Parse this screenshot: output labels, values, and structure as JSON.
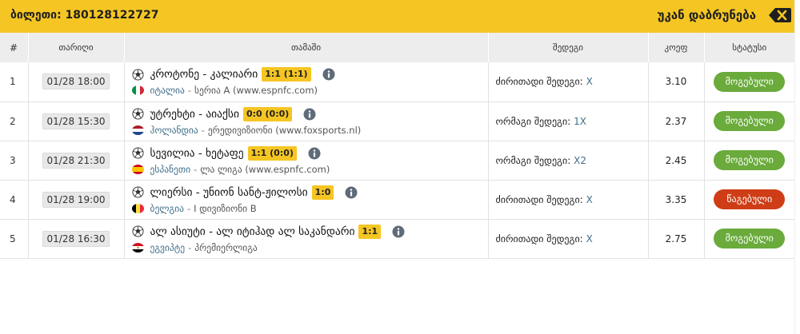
{
  "header": {
    "ticket_label": "ბილეთი:",
    "ticket_number": "180128122727",
    "back_label": "უკან დაბრუნება",
    "back_icon": "backspace-icon"
  },
  "table": {
    "columns": [
      "#",
      "თარიღი",
      "თამაში",
      "შედეგი",
      "კოეფ",
      "სტატუსი"
    ],
    "rows": [
      {
        "num": "1",
        "date": "01/28 18:00",
        "match": "კროტონე - კალიარი",
        "score": "1:1 (1:1)",
        "country": "იტალია",
        "league": "სერია A (www.espnfc.com)",
        "flag": "italy",
        "result_label": "ძირითადი შედეგი:",
        "pick": "X",
        "odds": "3.10",
        "status": "მოგებული",
        "status_type": "won"
      },
      {
        "num": "2",
        "date": "01/28 15:30",
        "match": "უტრეხტი - აიაქსი",
        "score": "0:0 (0:0)",
        "country": "ჰოლანდია",
        "league": "ერედივიზიონი (www.foxsports.nl)",
        "flag": "netherlands",
        "result_label": "ორმაგი შედეგი:",
        "pick": "1X",
        "odds": "2.37",
        "status": "მოგებული",
        "status_type": "won"
      },
      {
        "num": "3",
        "date": "01/28 21:30",
        "match": "სევილია - ხეტაფე",
        "score": "1:1 (0:0)",
        "country": "ესპანეთი",
        "league": "ლა ლიგა (www.espnfc.com)",
        "flag": "spain",
        "result_label": "ორმაგი შედეგი:",
        "pick": "X2",
        "odds": "2.45",
        "status": "მოგებული",
        "status_type": "won"
      },
      {
        "num": "4",
        "date": "01/28 19:00",
        "match": "ლიერსი - უნიონ სანტ-ჟილოსი",
        "score": "1:0",
        "country": "ბელგია",
        "league": "I დივიზიონი B",
        "flag": "belgium",
        "result_label": "ძირითადი შედეგი:",
        "pick": "X",
        "odds": "3.35",
        "status": "წაგებული",
        "status_type": "lost"
      },
      {
        "num": "5",
        "date": "01/28 16:30",
        "match": "ალ ასიუტი - ალ იტიჰად ალ საკანდარი",
        "score": "1:1",
        "country": "ეგვიპტე",
        "league": "პრემიერლიგა",
        "flag": "egypt",
        "result_label": "ძირითადი შედეგი:",
        "pick": "X",
        "odds": "2.75",
        "status": "მოგებული",
        "status_type": "won"
      }
    ]
  },
  "colors": {
    "accent": "#f5c623",
    "won": "#6aab3c",
    "lost": "#cf3d17",
    "link": "#3f6e8a",
    "header_bg": "#ededed"
  }
}
